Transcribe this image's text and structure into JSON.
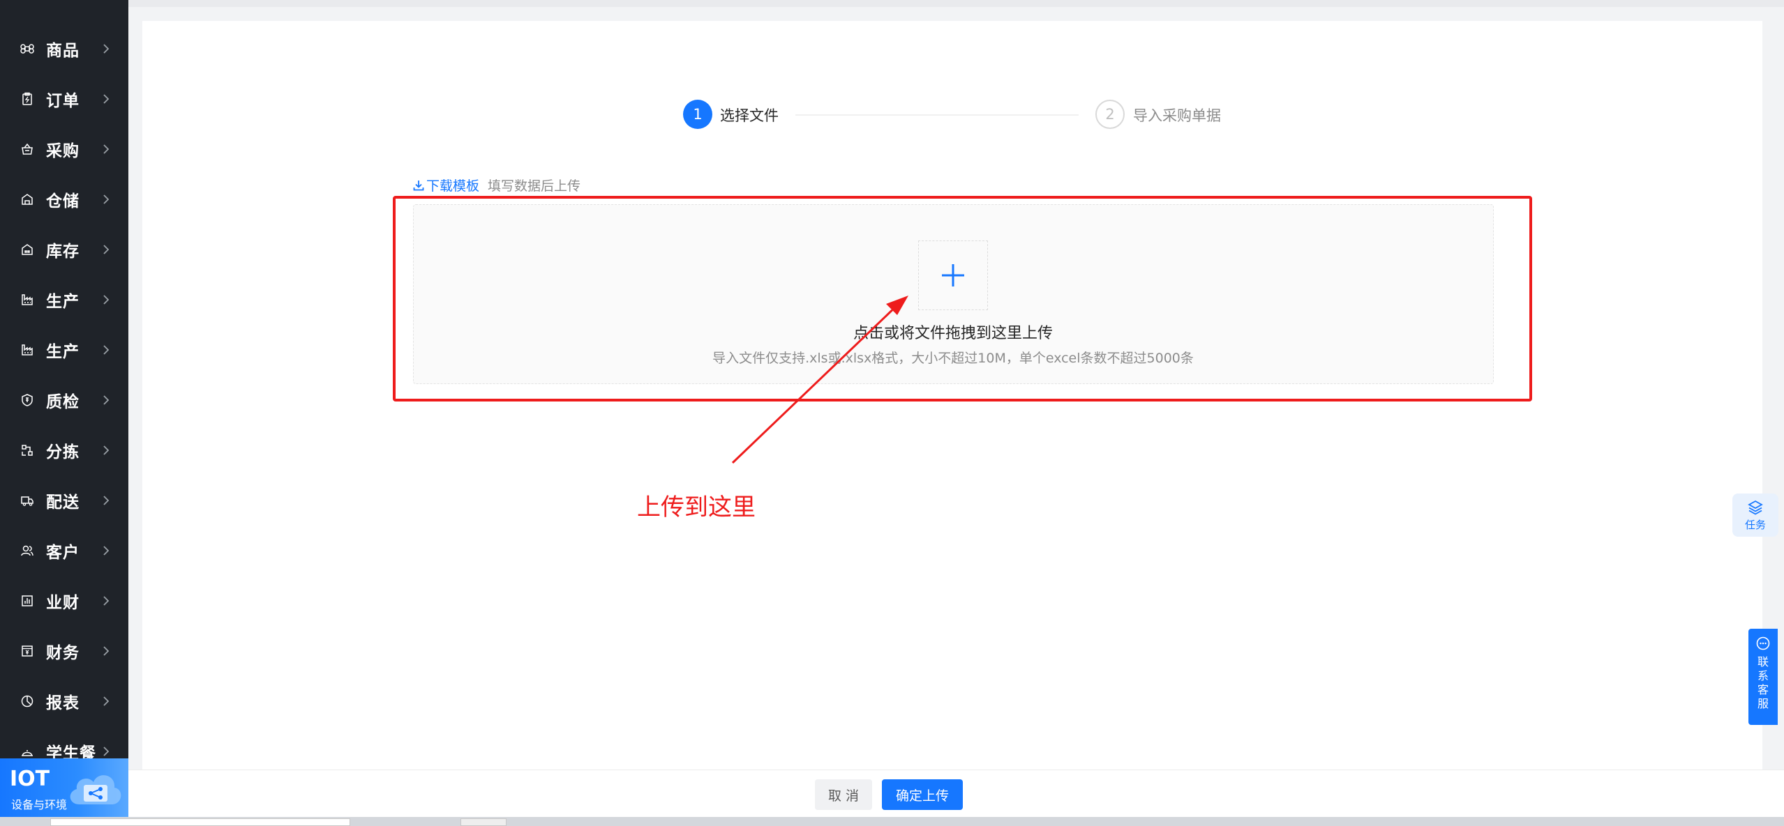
{
  "sidebar": {
    "items": [
      {
        "label": "商品",
        "icon": "command-icon"
      },
      {
        "label": "订单",
        "icon": "clipboard-icon"
      },
      {
        "label": "采购",
        "icon": "basket-icon"
      },
      {
        "label": "仓储",
        "icon": "warehouse-icon"
      },
      {
        "label": "库存",
        "icon": "inventory-icon"
      },
      {
        "label": "生产",
        "icon": "factory-icon"
      },
      {
        "label": "生产",
        "icon": "factory-icon"
      },
      {
        "label": "质检",
        "icon": "shield-icon"
      },
      {
        "label": "分拣",
        "icon": "sort-icon"
      },
      {
        "label": "配送",
        "icon": "truck-icon"
      },
      {
        "label": "客户",
        "icon": "users-icon"
      },
      {
        "label": "业财",
        "icon": "bar-chart-icon"
      },
      {
        "label": "财务",
        "icon": "finance-icon"
      },
      {
        "label": "报表",
        "icon": "pie-chart-icon"
      },
      {
        "label": "学生餐",
        "icon": "cloche-icon"
      }
    ],
    "iot": {
      "title": "IOT",
      "subtitle": "设备与环境"
    }
  },
  "steps": [
    {
      "number": "1",
      "label": "选择文件",
      "status": "active"
    },
    {
      "number": "2",
      "label": "导入采购单据",
      "status": "pending"
    }
  ],
  "download": {
    "link": "下载模板",
    "hint": "填写数据后上传"
  },
  "upload": {
    "title": "点击或将文件拖拽到这里上传",
    "subtitle": "导入文件仅支持.xls或.xlsx格式，大小不超过10M，单个excel条数不超过5000条"
  },
  "annotation": {
    "text": "上传到这里",
    "color": "#ee1c1c"
  },
  "widgets": {
    "task": "任务",
    "service": "联系客服"
  },
  "footer": {
    "cancel": "取 消",
    "confirm": "确定上传"
  },
  "colors": {
    "primary": "#1677ff",
    "sidebar": "#1f2329"
  }
}
